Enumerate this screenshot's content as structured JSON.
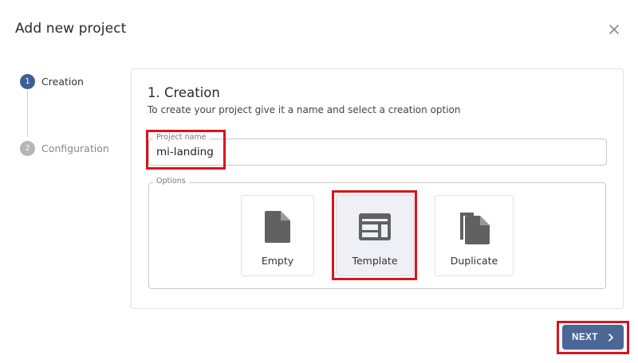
{
  "dialog": {
    "title": "Add new project"
  },
  "stepper": {
    "steps": [
      {
        "number": "1",
        "label": "Creation",
        "state": "active"
      },
      {
        "number": "2",
        "label": "Configuration",
        "state": "inactive"
      }
    ]
  },
  "creation": {
    "title": "1. Creation",
    "description": "To create your project give it a name and select a creation option",
    "project_name_label": "Project name",
    "project_name_value": "mi-landing",
    "options_label": "Options",
    "options": [
      {
        "label": "Empty",
        "icon": "file-icon"
      },
      {
        "label": "Template",
        "icon": "template-layout-icon",
        "selected": true
      },
      {
        "label": "Duplicate",
        "icon": "duplicate-files-icon"
      }
    ]
  },
  "footer": {
    "next_label": "NEXT"
  },
  "colors": {
    "primary": "#4a6795",
    "step_active": "#3f5f93",
    "step_inactive": "#b5b5b5",
    "highlight": "#d9141e",
    "icon": "#616161"
  }
}
